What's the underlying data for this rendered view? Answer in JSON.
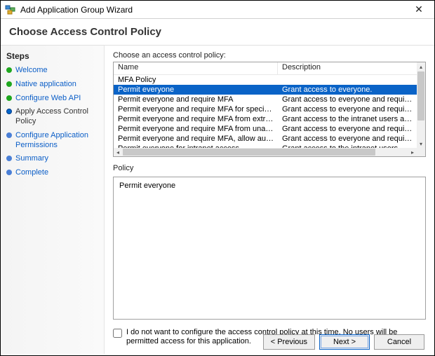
{
  "window": {
    "title": "Add Application Group Wizard"
  },
  "heading": "Choose Access Control Policy",
  "sidebar": {
    "title": "Steps",
    "items": [
      {
        "label": "Welcome",
        "state": "done"
      },
      {
        "label": "Native application",
        "state": "done"
      },
      {
        "label": "Configure Web API",
        "state": "done"
      },
      {
        "label": "Apply Access Control Policy",
        "state": "current"
      },
      {
        "label": "Configure Application Permissions",
        "state": "pending"
      },
      {
        "label": "Summary",
        "state": "pending"
      },
      {
        "label": "Complete",
        "state": "pending"
      }
    ]
  },
  "main": {
    "list_label": "Choose an access control policy:",
    "columns": {
      "name": "Name",
      "description": "Description"
    },
    "policies": [
      {
        "name": "MFA Policy",
        "description": ""
      },
      {
        "name": "Permit everyone",
        "description": "Grant access to everyone.",
        "selected": true
      },
      {
        "name": "Permit everyone and require MFA",
        "description": "Grant access to everyone and require MFA f..."
      },
      {
        "name": "Permit everyone and require MFA for specific group",
        "description": "Grant access to everyone and require MFA f..."
      },
      {
        "name": "Permit everyone and require MFA from extranet access",
        "description": "Grant access to the intranet users and requir..."
      },
      {
        "name": "Permit everyone and require MFA from unauthenticated ...",
        "description": "Grant access to everyone and require MFA f..."
      },
      {
        "name": "Permit everyone and require MFA, allow automatic devi...",
        "description": "Grant access to everyone and require MFA f..."
      },
      {
        "name": "Permit everyone for intranet access",
        "description": "Grant access to the intranet users."
      }
    ],
    "policy_label": "Policy",
    "policy_text": "Permit everyone",
    "opt_out_label": "I do not want to configure the access control policy at this time.  No users will be permitted access for this application."
  },
  "buttons": {
    "previous": "< Previous",
    "next": "Next >",
    "cancel": "Cancel"
  }
}
